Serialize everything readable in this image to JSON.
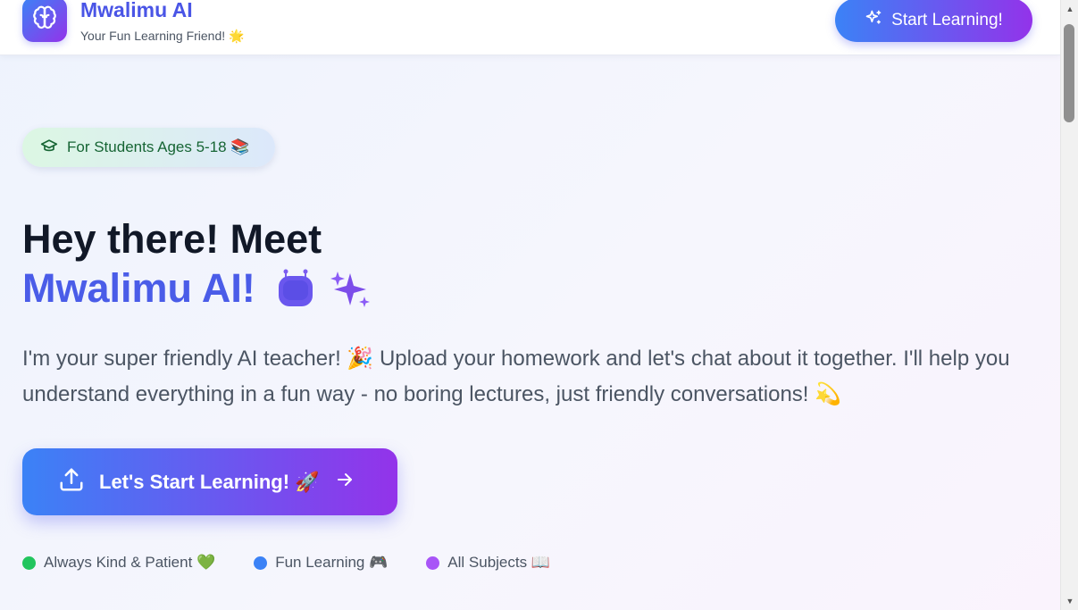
{
  "header": {
    "brand_title": "Mwalimu AI",
    "brand_subtitle": "Your Fun Learning Friend! 🌟",
    "start_button_label": "Start Learning!",
    "logo_icon": "brain-icon"
  },
  "hero": {
    "badge_label": "For Students Ages 5-18 📚",
    "badge_icon": "graduation-cap-icon",
    "headline_line1": "Hey there! Meet",
    "headline_line2": "Mwalimu AI!",
    "headline_emojis": [
      "robot-icon",
      "sparkles-icon"
    ],
    "description": "I'm your super friendly AI teacher! 🎉 Upload your homework and let's chat about it together. I'll help you understand everything in a fun way - no boring lectures, just friendly conversations! 💫",
    "cta_label": "Let's Start Learning! 🚀",
    "cta_icons": [
      "upload-icon",
      "arrow-right-icon"
    ]
  },
  "features": [
    {
      "label": "Always Kind & Patient 💚",
      "color": "#22c55e"
    },
    {
      "label": "Fun Learning 🎮",
      "color": "#3b82f6"
    },
    {
      "label": "All Subjects 📖",
      "color": "#a855f7"
    }
  ],
  "colors": {
    "accent_blue": "#3b82f6",
    "accent_purple": "#9333ea",
    "brand_text": "#4a55e6"
  }
}
